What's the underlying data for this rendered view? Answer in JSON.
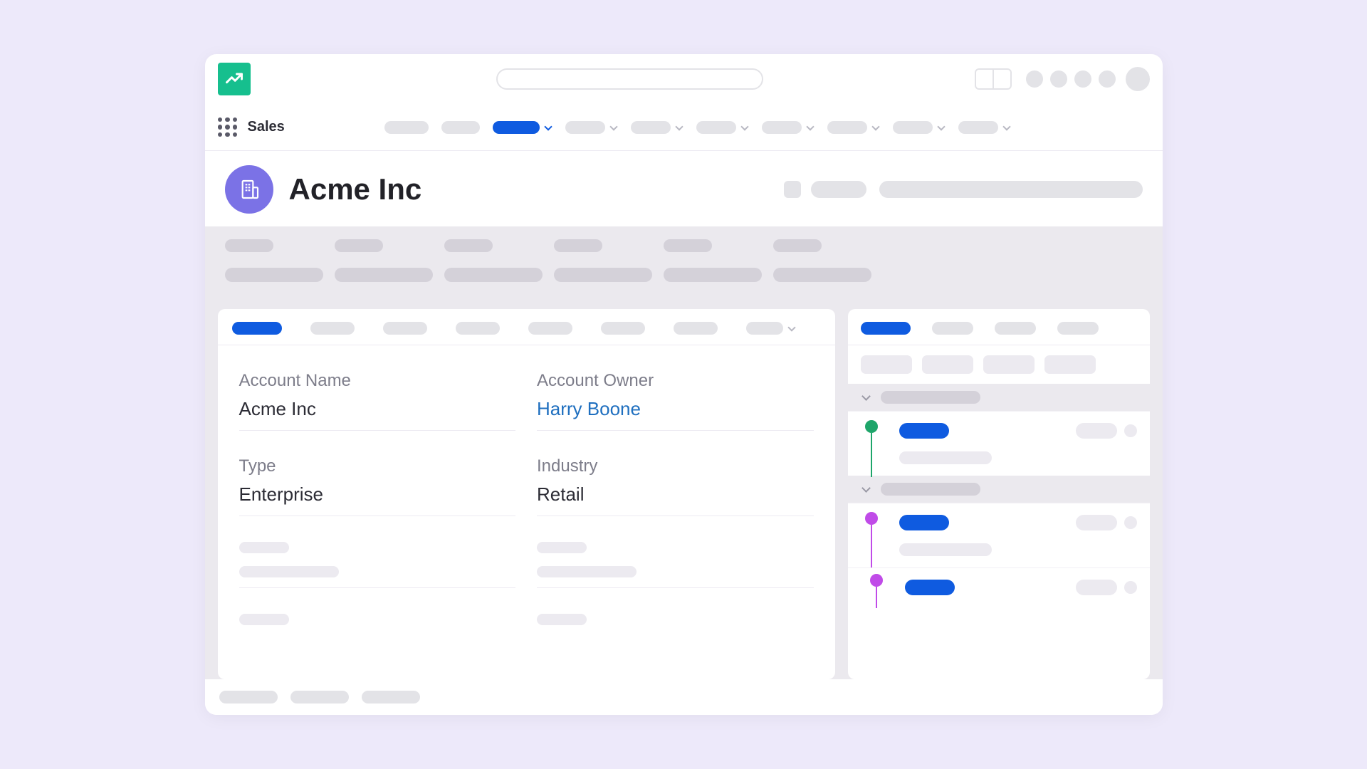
{
  "nav": {
    "app_label": "Sales"
  },
  "page": {
    "title": "Acme Inc"
  },
  "details": {
    "account_name_label": "Account Name",
    "account_name_value": "Acme Inc",
    "account_owner_label": "Account Owner",
    "account_owner_value": "Harry Boone",
    "type_label": "Type",
    "type_value": "Enterprise",
    "industry_label": "Industry",
    "industry_value": "Retail"
  },
  "colors": {
    "accent_blue": "#0f5be0",
    "accent_purple": "#7b72e6",
    "accent_green": "#16bf8e",
    "dot_green": "#1ea56a",
    "dot_purple": "#c04be8"
  }
}
